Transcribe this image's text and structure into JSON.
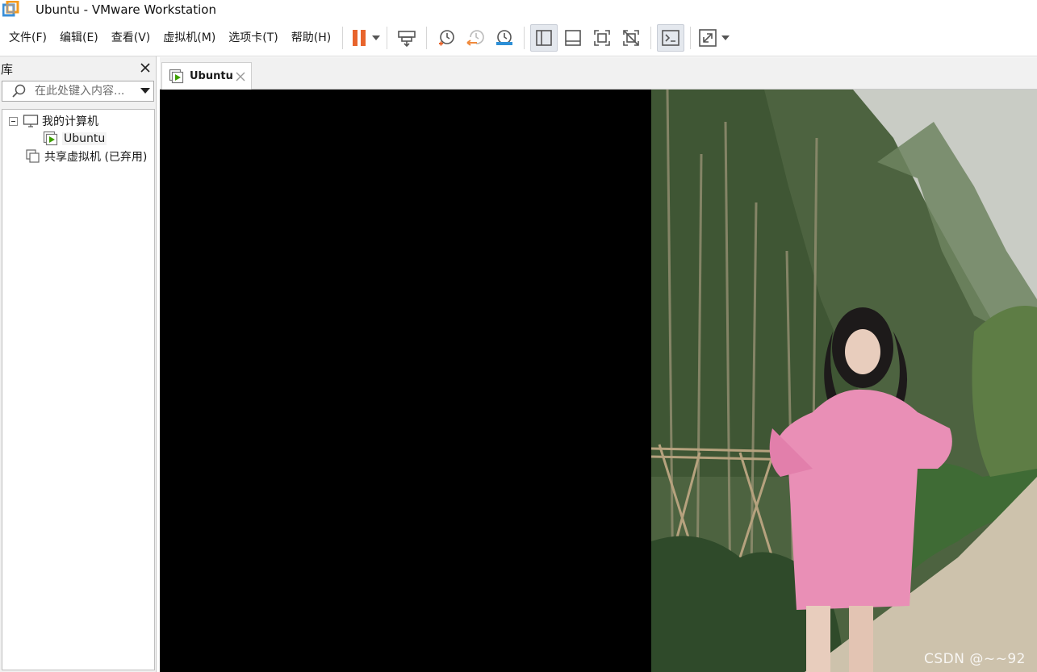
{
  "window": {
    "title": "Ubuntu - VMware Workstation"
  },
  "menu": [
    "文件(F)",
    "编辑(E)",
    "查看(V)",
    "虚拟机(M)",
    "选项卡(T)",
    "帮助(H)"
  ],
  "library": {
    "title": "库",
    "search_placeholder": "在此处键入内容...",
    "tree": {
      "my_computer": "我的计算机",
      "vm": "Ubuntu",
      "shared": "共享虚拟机 (已弃用)"
    }
  },
  "tabs": [
    {
      "label": "Ubuntu"
    }
  ],
  "vm_display": {
    "watermark": "CSDN @~~92"
  },
  "colors": {
    "pause": "#e8642c",
    "vm_green": "#3ea000",
    "revert_orange": "#f08a3c",
    "manage_blue": "#2d8fd6"
  }
}
